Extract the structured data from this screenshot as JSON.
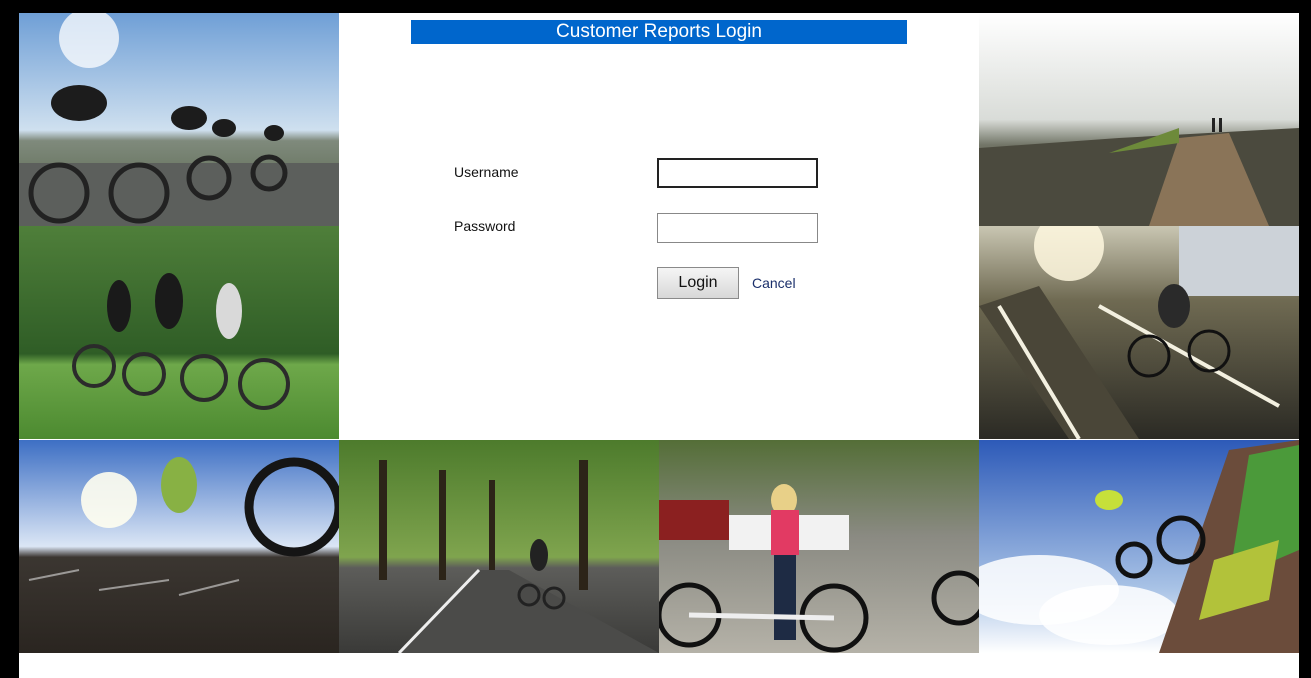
{
  "header": {
    "title": "Customer Reports Login"
  },
  "form": {
    "username_label": "Username",
    "username_value": "",
    "password_label": "Password",
    "password_value": "",
    "login_label": "Login",
    "cancel_label": "Cancel"
  },
  "colors": {
    "header_bg": "#0066cc",
    "header_text": "#ffffff",
    "page_bg": "#ffffff",
    "frame_bg": "#000000"
  },
  "images": [
    {
      "name": "photo-road-cyclists",
      "subject": "road cyclists racing"
    },
    {
      "name": "photo-coastal-trail",
      "subject": "hikers on coastal trail"
    },
    {
      "name": "photo-park-riders",
      "subject": "three riders in park"
    },
    {
      "name": "photo-city-cyclist",
      "subject": "cyclist on sunny city lane"
    },
    {
      "name": "photo-bmx-jump-wall",
      "subject": "bmx rider jumping over graffiti wall"
    },
    {
      "name": "photo-tree-avenue",
      "subject": "cyclist on tree-lined avenue"
    },
    {
      "name": "photo-woman-bike",
      "subject": "woman walking white bicycle"
    },
    {
      "name": "photo-bmx-ramp",
      "subject": "bmx rider on graffiti ramp"
    }
  ]
}
